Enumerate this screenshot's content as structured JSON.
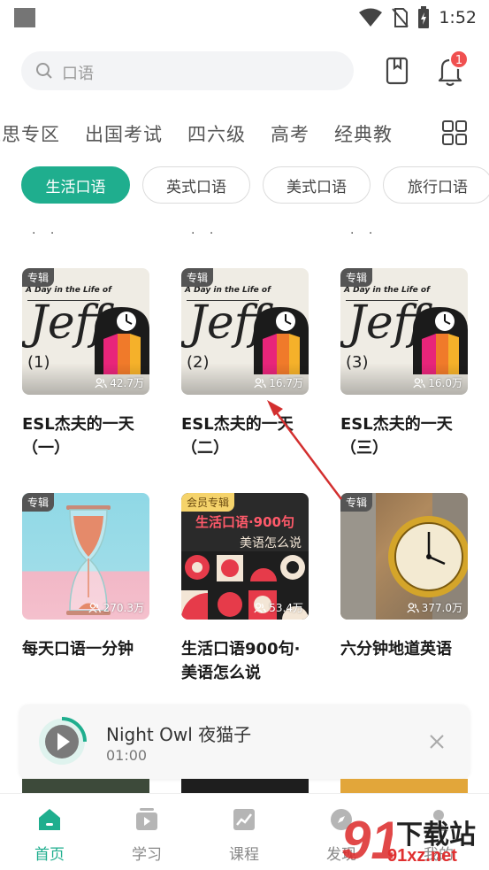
{
  "status": {
    "time": "1:52"
  },
  "search": {
    "placeholder": "口语"
  },
  "notifications": {
    "badge": "1"
  },
  "categories": [
    "雅思专区",
    "出国考试",
    "四六级",
    "高考",
    "经典教"
  ],
  "chips": [
    {
      "label": "生活口语",
      "active": true
    },
    {
      "label": "英式口语",
      "active": false
    },
    {
      "label": "美式口语",
      "active": false
    },
    {
      "label": "旅行口语",
      "active": false
    }
  ],
  "albums": [
    {
      "tag": "专辑",
      "title": "ESL杰夫的一天（一）",
      "plays": "42.7万",
      "art_top": "A Day in the Life of",
      "art_main": "Jeff",
      "art_num": "(1)"
    },
    {
      "tag": "专辑",
      "title": "ESL杰夫的一天（二）",
      "plays": "16.7万",
      "art_top": "A Day in the Life of",
      "art_main": "Jeff",
      "art_num": "(2)"
    },
    {
      "tag": "专辑",
      "title": "ESL杰夫的一天（三）",
      "plays": "16.0万",
      "art_top": "A Day in the Life of",
      "art_main": "Jeff",
      "art_num": "(3)"
    },
    {
      "tag": "专辑",
      "title": "每天口语一分钟",
      "plays": "270.3万"
    },
    {
      "tag": "会员专辑",
      "title": "生活口语900句·美语怎么说",
      "plays": "53.4万",
      "art_line1": "生活口语·900句",
      "art_line2": "美语怎么说"
    },
    {
      "tag": "专辑",
      "title": "六分钟地道英语",
      "plays": "377.0万"
    }
  ],
  "player": {
    "title": "Night Owl 夜猫子",
    "time": "01:00"
  },
  "nav": [
    {
      "label": "首页",
      "icon": "home-icon",
      "active": true
    },
    {
      "label": "学习",
      "icon": "play-square-icon",
      "active": false
    },
    {
      "label": "课程",
      "icon": "chart-icon",
      "active": false
    },
    {
      "label": "发现",
      "icon": "compass-icon",
      "active": false
    },
    {
      "label": "我的",
      "icon": "person-icon",
      "active": false
    }
  ],
  "watermark": {
    "brand": "下载站",
    "url": "91xz.net",
    "logo_digits": "91"
  },
  "colors": {
    "accent": "#1fae8e",
    "badge": "#f05050",
    "arrow": "#d32f2f"
  }
}
